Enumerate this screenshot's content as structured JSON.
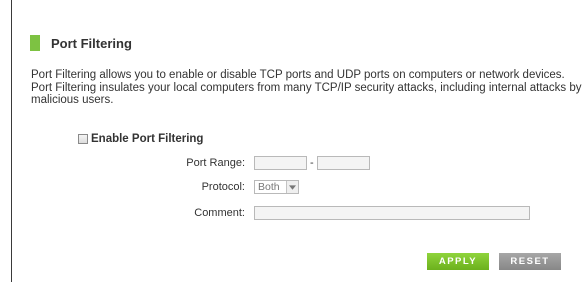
{
  "accent_color": "#7dc242",
  "section": {
    "title": "Port Filtering",
    "description_line1": "Port Filtering allows you to enable or disable TCP ports and UDP ports on computers or network devices.",
    "description_line2": "Port Filtering insulates your local computers from many TCP/IP security attacks, including internal attacks by malicious users."
  },
  "enable_checkbox": {
    "label": "Enable Port Filtering",
    "checked": false
  },
  "form": {
    "port_range_label": "Port Range:",
    "port_range_start": "",
    "port_range_separator": "-",
    "port_range_end": "",
    "protocol_label": "Protocol:",
    "protocol_value": "Both",
    "comment_label": "Comment:",
    "comment_value": ""
  },
  "buttons": {
    "apply_label": "APPLY",
    "reset_label": "RESET"
  },
  "icons": {
    "select_arrow": "chevron-down-icon",
    "section_marker": "section-marker-icon"
  }
}
